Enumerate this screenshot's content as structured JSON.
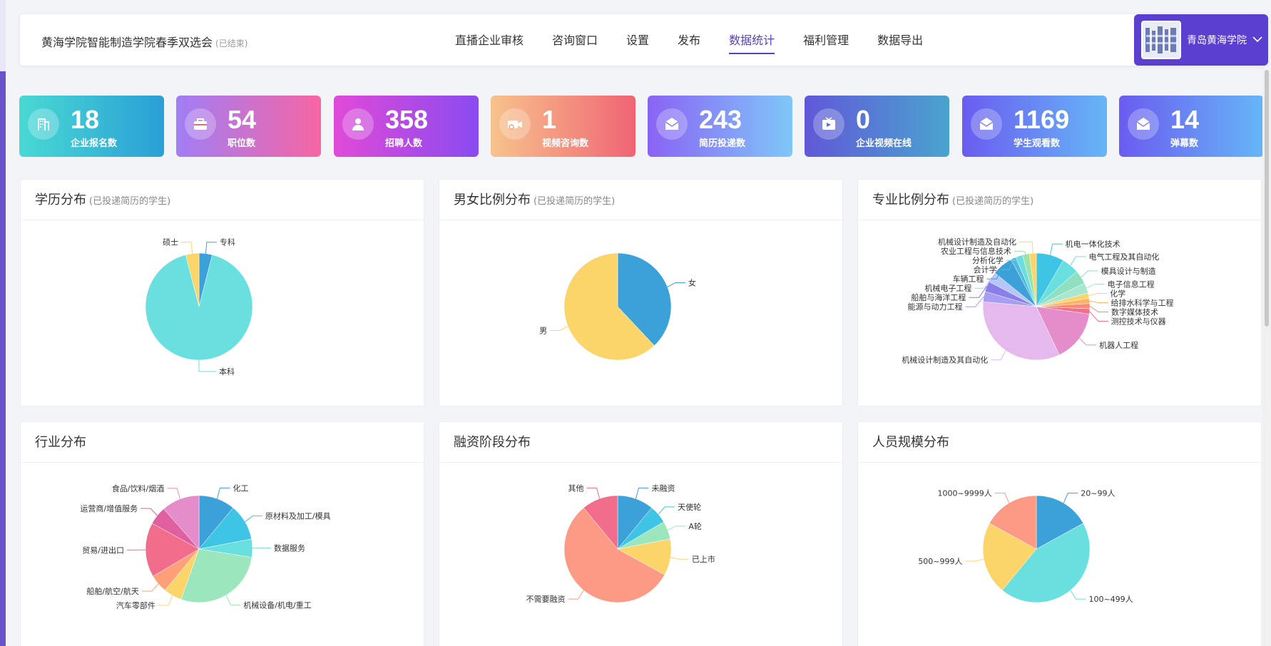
{
  "header": {
    "title": "黄海学院智能制造学院春季双选会",
    "status": "(已结束)",
    "nav": [
      "直播企业审核",
      "咨询窗口",
      "设置",
      "发布",
      "数据统计",
      "福利管理",
      "数据导出"
    ],
    "active_nav": "数据统计",
    "school_name": "青岛黄海学院"
  },
  "stats": [
    {
      "value": "18",
      "label": "企业报名数",
      "icon": "building-icon",
      "gradient": [
        "#49d9d4",
        "#2a9fd6"
      ]
    },
    {
      "value": "54",
      "label": "职位数",
      "icon": "briefcase-icon",
      "gradient": [
        "#a07ef5",
        "#f765a3"
      ]
    },
    {
      "value": "358",
      "label": "招聘人数",
      "icon": "person-icon",
      "gradient": [
        "#e04ad8",
        "#8a4bf0"
      ]
    },
    {
      "value": "1",
      "label": "视频咨询数",
      "icon": "video-camera-icon",
      "gradient": [
        "#f7c38c",
        "#f06474"
      ]
    },
    {
      "value": "243",
      "label": "简历投递数",
      "icon": "envelope-icon",
      "gradient": [
        "#8a63f5",
        "#7fc7f8"
      ]
    },
    {
      "value": "0",
      "label": "企业视频在线",
      "icon": "tv-icon",
      "gradient": [
        "#6158d8",
        "#4aa4cf"
      ]
    },
    {
      "value": "1169",
      "label": "学生观看数",
      "icon": "envelope-icon",
      "gradient": [
        "#6a5cf0",
        "#66b6f7"
      ]
    },
    {
      "value": "14",
      "label": "弹幕数",
      "icon": "envelope-icon",
      "gradient": [
        "#6a5cf0",
        "#66b6f7"
      ]
    }
  ],
  "cards": [
    {
      "title": "学历分布",
      "subtitle": "(已投递简历的学生)"
    },
    {
      "title": "男女比例分布",
      "subtitle": "(已投递简历的学生)"
    },
    {
      "title": "专业比例分布",
      "subtitle": "(已投递简历的学生)"
    },
    {
      "title": "行业分布",
      "subtitle": ""
    },
    {
      "title": "融资阶段分布",
      "subtitle": ""
    },
    {
      "title": "人员规模分布",
      "subtitle": ""
    }
  ],
  "chart_data": [
    {
      "type": "pie",
      "title": "学历分布",
      "categories": [
        "专科",
        "本科",
        "硕士"
      ],
      "values": [
        4,
        92,
        4
      ],
      "colors": [
        "#3ca0d9",
        "#6adfe0",
        "#fcd56a"
      ]
    },
    {
      "type": "pie",
      "title": "男女比例分布",
      "categories": [
        "女",
        "男"
      ],
      "values": [
        38,
        62
      ],
      "colors": [
        "#3ca0d9",
        "#fcd56a"
      ]
    },
    {
      "type": "pie",
      "title": "专业比例分布",
      "categories": [
        "机电一体化技术",
        "电气工程及其自动化",
        "模具设计与制造",
        "电子信息工程",
        "化学",
        "给排水科学与工程",
        "数字媒体技术",
        "测控技术与仪器",
        "机器人工程",
        "机械设计制造及其自动化",
        "能源与动力工程",
        "船舶与海洋工程",
        "机械电子工程",
        "车辆工程",
        "会计学",
        "分析化学",
        "农业工程与信息技术",
        "机械设计制造及自动化"
      ],
      "values": [
        8,
        5,
        4,
        3,
        1.5,
        1.5,
        1.5,
        1.5,
        15,
        32,
        3,
        3,
        3,
        6,
        1.5,
        2,
        2,
        2
      ],
      "colors": [
        "#3ec5e5",
        "#6adfe0",
        "#8fe0c0",
        "#a8e6cf",
        "#fcd56a",
        "#ffb26b",
        "#fd8a70",
        "#f26d8b",
        "#e58ccb",
        "#e5b9ee",
        "#a79df2",
        "#8a7ee8",
        "#b5c6f7",
        "#3ca0d9",
        "#52b8e0",
        "#6adfe0",
        "#9be3a9",
        "#fcd56a"
      ]
    },
    {
      "type": "pie",
      "title": "行业分布",
      "categories": [
        "化工",
        "原材料及加工/模具",
        "数据服务",
        "机械设备/机电/重工",
        "汽车零部件",
        "船舶/航空/航天",
        "贸易/进出口",
        "运营商/增值服务",
        "食品/饮料/烟酒"
      ],
      "values": [
        11,
        11,
        5.5,
        28,
        5.5,
        5.5,
        16.5,
        5.5,
        11.5
      ],
      "colors": [
        "#3ca0d9",
        "#3ec5e5",
        "#6adfe0",
        "#9ce6bd",
        "#fcd56a",
        "#ffa07a",
        "#f26d8b",
        "#e05fa0",
        "#e58ccb"
      ]
    },
    {
      "type": "pie",
      "title": "融资阶段分布",
      "categories": [
        "未融资",
        "天使轮",
        "A轮",
        "已上市",
        "不需要融资",
        "其他"
      ],
      "values": [
        11,
        5.5,
        5.5,
        11,
        56,
        11
      ],
      "colors": [
        "#3ca0d9",
        "#3ec5e5",
        "#9ce6bd",
        "#fcd56a",
        "#fd9a85",
        "#f26d8b"
      ]
    },
    {
      "type": "pie",
      "title": "人员规模分布",
      "categories": [
        "20~99人",
        "100~499人",
        "500~999人",
        "1000~9999人"
      ],
      "values": [
        17,
        44,
        22,
        17
      ],
      "colors": [
        "#3ca0d9",
        "#6adfe0",
        "#fcd56a",
        "#fd9a85"
      ]
    }
  ]
}
